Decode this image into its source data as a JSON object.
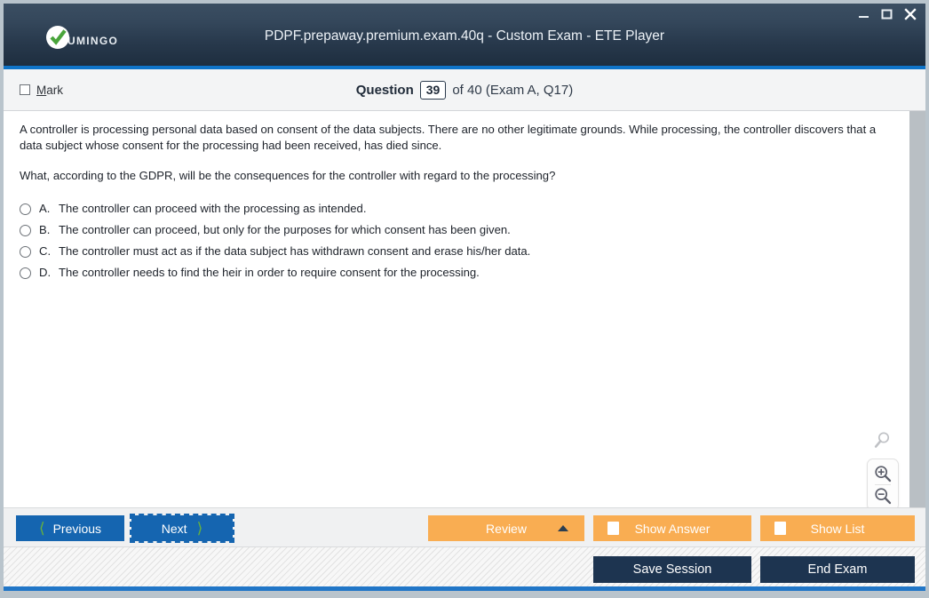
{
  "window": {
    "title": "PDPF.prepaway.premium.exam.40q - Custom Exam - ETE Player",
    "logo_text": "UMINGO",
    "controls": {
      "minimize": "minimize-icon",
      "maximize": "maximize-icon",
      "close": "close-icon"
    },
    "colors": {
      "header_top": "#3b4e62",
      "header_bottom": "#1c2c3d",
      "accent_blue": "#0f74c8",
      "primary_blue": "#1565b0",
      "orange": "#f9ad52",
      "dark_navy": "#1d3450",
      "chevron_green": "#67b23c"
    }
  },
  "question_bar": {
    "mark_label_prefix": "M",
    "mark_label_rest": "ark",
    "question_word": "Question",
    "question_number": "39",
    "rest": "of 40 (Exam A, Q17)"
  },
  "question": {
    "stem_paragraph_1": "A controller is processing personal data based on consent of the data subjects. There are no other legitimate grounds. While processing, the controller discovers that a data subject whose consent for the processing had been received, has died since.",
    "stem_paragraph_2": "What, according to the GDPR, will be the consequences for the controller with regard to the processing?",
    "options": [
      {
        "letter": "A.",
        "text": "The controller can proceed with the processing as intended.",
        "selected": false
      },
      {
        "letter": "B.",
        "text": "The controller can proceed, but only for the purposes for which consent has been given.",
        "selected": false
      },
      {
        "letter": "C.",
        "text": "The controller must act as if the data subject has withdrawn consent and erase his/her data.",
        "selected": false
      },
      {
        "letter": "D.",
        "text": "The controller needs to find the heir in order to require consent for the processing.",
        "selected": false
      }
    ]
  },
  "zoom_tools": {
    "handle_icon": "magnifier-icon",
    "zoom_in_icon": "zoom-in-icon",
    "zoom_out_icon": "zoom-out-icon"
  },
  "toolbar": {
    "previous_label": "Previous",
    "next_label": "Next",
    "review_label": "Review",
    "show_answer_label": "Show Answer",
    "show_list_label": "Show List"
  },
  "footer": {
    "save_session_label": "Save Session",
    "end_exam_label": "End Exam"
  }
}
